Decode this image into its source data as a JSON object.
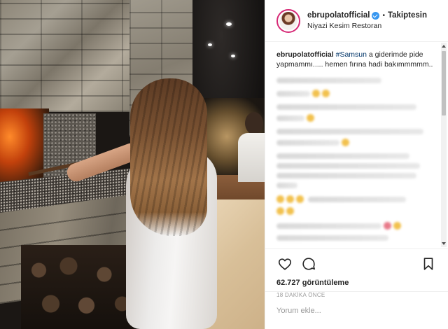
{
  "post": {
    "username": "ebrupolatofficial",
    "verified": true,
    "separator": "•",
    "follow_state": "Takiptesin",
    "location": "Niyazi Kesim Restoran"
  },
  "caption": {
    "username": "ebrupolatofficial",
    "hashtag": "#Samsun",
    "text": " a giderimde pide yapmammı..... hemen fırına hadi bakımmmmm.."
  },
  "comments_blurred": true,
  "actions": {
    "like_icon": "heart-outline-icon",
    "comment_icon": "speech-bubble-icon",
    "save_icon": "bookmark-icon"
  },
  "stats": {
    "views_count": "62.727",
    "views_label": "görüntüleme",
    "time_ago": "18 DAKİKA ÖNCE"
  },
  "comment_box": {
    "placeholder": "Yorum ekle..."
  },
  "colors": {
    "verified_badge": "#3897f0",
    "hashtag": "#003569",
    "text_primary": "#262626",
    "text_secondary": "#999999",
    "divider": "#efefef"
  }
}
